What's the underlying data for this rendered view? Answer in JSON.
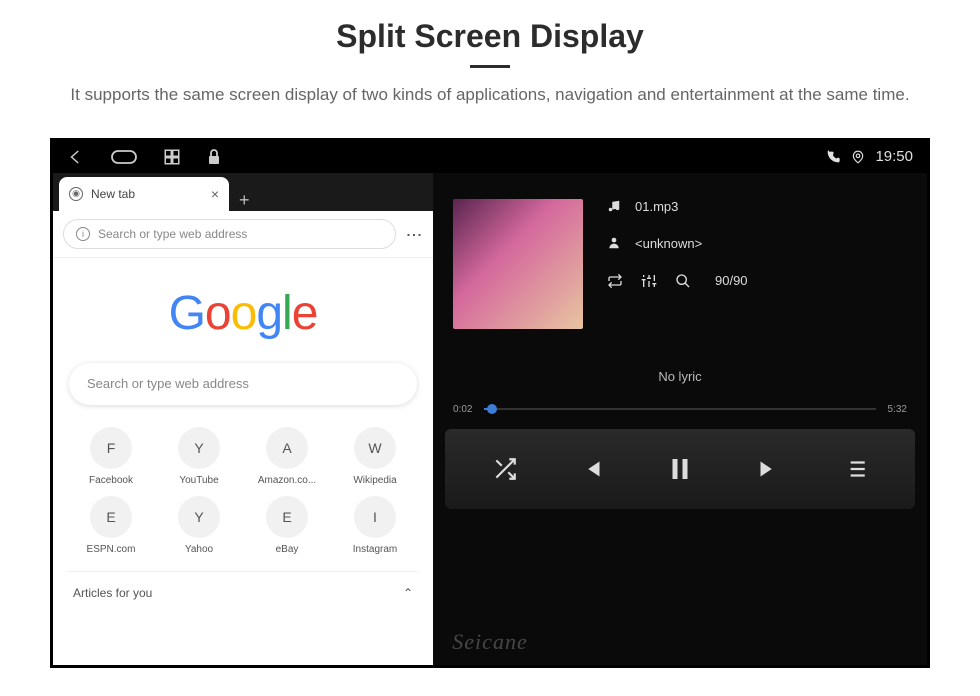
{
  "page": {
    "title": "Split Screen Display",
    "subtitle": "It supports the same screen display of two kinds of applications, navigation and entertainment at the same time."
  },
  "status_bar": {
    "time": "19:50"
  },
  "browser": {
    "tab_title": "New tab",
    "address_placeholder": "Search or type web address",
    "search_placeholder": "Search or type web address",
    "shortcuts": [
      {
        "letter": "F",
        "label": "Facebook"
      },
      {
        "letter": "Y",
        "label": "YouTube"
      },
      {
        "letter": "A",
        "label": "Amazon.co..."
      },
      {
        "letter": "W",
        "label": "Wikipedia"
      },
      {
        "letter": "E",
        "label": "ESPN.com"
      },
      {
        "letter": "Y",
        "label": "Yahoo"
      },
      {
        "letter": "E",
        "label": "eBay"
      },
      {
        "letter": "I",
        "label": "Instagram"
      }
    ],
    "articles_header": "Articles for you",
    "logo": {
      "c1": "G",
      "c2": "o",
      "c3": "o",
      "c4": "g",
      "c5": "l",
      "c6": "e"
    }
  },
  "player": {
    "track_name": "01.mp3",
    "artist": "<unknown>",
    "track_count": "90/90",
    "lyric": "No lyric",
    "elapsed": "0:02",
    "duration": "5:32"
  },
  "watermark": "Seicane"
}
